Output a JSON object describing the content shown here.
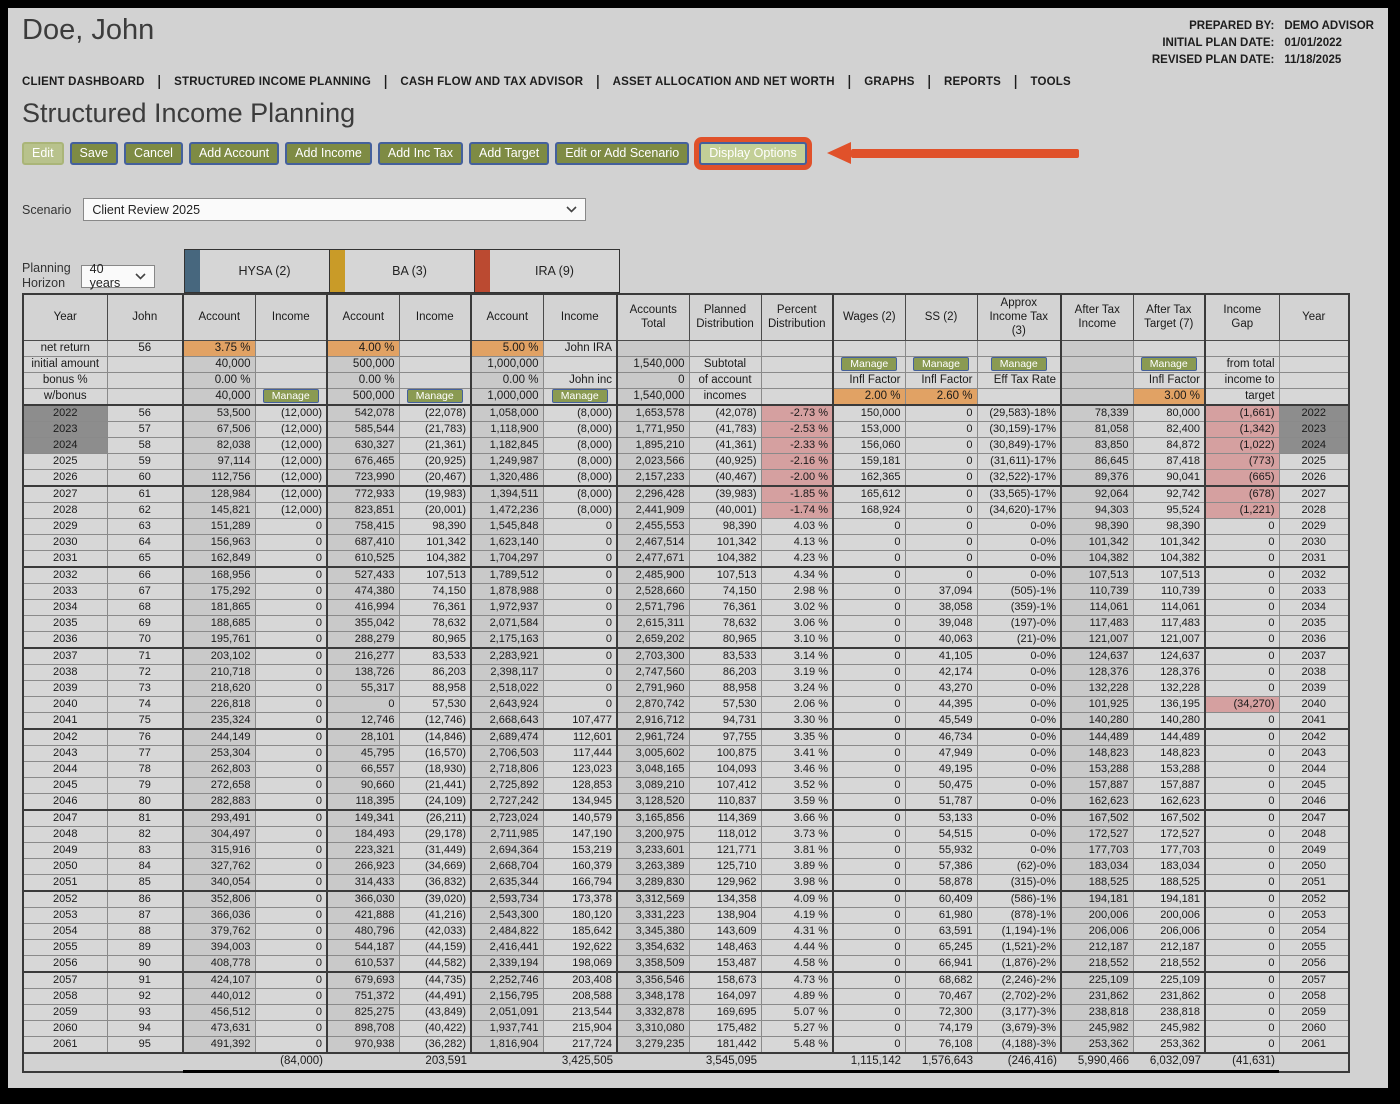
{
  "window": {
    "client_name": "Doe, John",
    "prepared_by_label": "PREPARED BY:",
    "prepared_by": "DEMO ADVISOR",
    "initial_plan_label": "INITIAL PLAN DATE:",
    "initial_plan_date": "01/01/2022",
    "revised_plan_label": "REVISED PLAN DATE:",
    "revised_plan_date": "11/18/2025"
  },
  "nav": {
    "items": [
      "CLIENT DASHBOARD",
      "STRUCTURED INCOME PLANNING",
      "CASH FLOW AND TAX ADVISOR",
      "ASSET ALLOCATION AND NET WORTH",
      "GRAPHS",
      "REPORTS",
      "TOOLS"
    ]
  },
  "page": {
    "title": "Structured Income Planning"
  },
  "toolbar": {
    "buttons": [
      {
        "label": "Edit",
        "state": "disabled"
      },
      {
        "label": "Save",
        "state": "normal"
      },
      {
        "label": "Cancel",
        "state": "normal"
      },
      {
        "label": "Add Account",
        "state": "normal"
      },
      {
        "label": "Add Income",
        "state": "normal"
      },
      {
        "label": "Add Inc Tax",
        "state": "normal"
      },
      {
        "label": "Add Target",
        "state": "normal"
      },
      {
        "label": "Edit or Add Scenario",
        "state": "normal"
      },
      {
        "label": "Display Options",
        "state": "highlighted"
      }
    ]
  },
  "scenario": {
    "label": "Scenario",
    "value": "Client Review 2025"
  },
  "planning_horizon": {
    "label": "Planning\nHorizon",
    "value": "40 years"
  },
  "accounts_legend": [
    {
      "name": "HYSA (2)",
      "color": "#47677e"
    },
    {
      "name": "BA (3)",
      "color": "#c99b28"
    },
    {
      "name": "IRA (9)",
      "color": "#bb4a31"
    }
  ],
  "colors": {
    "accent_callout": "#e0512a",
    "button_green": "#7e8b44",
    "highlight_cell": "#e1a264",
    "negative_cell": "#d5a0a0",
    "past_year_cell": "#8d8d8d"
  },
  "table": {
    "columns": [
      "Year",
      "John",
      "Account",
      "Income",
      "Account",
      "Income",
      "Account",
      "Income",
      "Accounts\nTotal",
      "Planned\nDistribution",
      "Percent\nDistribution",
      "Wages (2)",
      "SS (2)",
      "Approx\nIncome Tax\n(3)",
      "After Tax\nIncome",
      "After Tax\nTarget (7)",
      "Income\nGap",
      "Year"
    ],
    "spec_rows": [
      [
        "net return",
        "56",
        {
          "v": "3.75  %",
          "c": "hl"
        },
        "",
        {
          "v": "4.00  %",
          "c": "hl"
        },
        "",
        {
          "v": "5.00  %",
          "c": "hl"
        },
        "John IRA",
        "",
        "",
        "",
        "",
        "",
        "",
        "",
        "",
        "",
        ""
      ],
      [
        "initial amount",
        "",
        "40,000",
        "",
        "500,000",
        "",
        "1,000,000",
        "",
        "1,540,000",
        {
          "v": "Subtotal",
          "c": "ctr"
        },
        "",
        {
          "b": "Manage"
        },
        {
          "b": "Manage"
        },
        {
          "b": "Manage"
        },
        "",
        {
          "b": "Manage"
        },
        "from total",
        ""
      ],
      [
        "bonus %",
        "",
        "0.00  %",
        "",
        "0.00  %",
        "",
        "0.00  %",
        "John inc",
        "0",
        {
          "v": "of account",
          "c": "ctr"
        },
        "",
        "Infl Factor",
        "Infl Factor",
        "Eff Tax Rate",
        "",
        "Infl Factor",
        "income to",
        ""
      ],
      [
        "w/bonus",
        "",
        "40,000",
        {
          "b": "Manage"
        },
        "500,000",
        {
          "b": "Manage"
        },
        "1,000,000",
        {
          "b": "Manage"
        },
        "1,540,000",
        {
          "v": "incomes",
          "c": "ctr"
        },
        "",
        {
          "v": "2.00  %",
          "c": "hl"
        },
        {
          "v": "2.60  %",
          "c": "hl"
        },
        "",
        "",
        {
          "v": "3.00  %",
          "c": "hl"
        },
        "target",
        ""
      ]
    ],
    "rows": [
      [
        "2022",
        "56",
        "53,500",
        "(12,000)",
        "542,078",
        "(22,078)",
        "1,058,000",
        "(8,000)",
        "1,653,578",
        "(42,078)",
        "-2.73  %",
        "150,000",
        "0",
        "(29,583)-18%",
        "78,339",
        "80,000",
        "(1,661)",
        "2022"
      ],
      [
        "2023",
        "57",
        "67,506",
        "(12,000)",
        "585,544",
        "(21,783)",
        "1,118,900",
        "(8,000)",
        "1,771,950",
        "(41,783)",
        "-2.53  %",
        "153,000",
        "0",
        "(30,159)-17%",
        "81,058",
        "82,400",
        "(1,342)",
        "2023"
      ],
      [
        "2024",
        "58",
        "82,038",
        "(12,000)",
        "630,327",
        "(21,361)",
        "1,182,845",
        "(8,000)",
        "1,895,210",
        "(41,361)",
        "-2.33  %",
        "156,060",
        "0",
        "(30,849)-17%",
        "83,850",
        "84,872",
        "(1,022)",
        "2024"
      ],
      [
        "2025",
        "59",
        "97,114",
        "(12,000)",
        "676,465",
        "(20,925)",
        "1,249,987",
        "(8,000)",
        "2,023,566",
        "(40,925)",
        "-2.16  %",
        "159,181",
        "0",
        "(31,611)-17%",
        "86,645",
        "87,418",
        "(773)",
        "2025"
      ],
      [
        "2026",
        "60",
        "112,756",
        "(12,000)",
        "723,990",
        "(20,467)",
        "1,320,486",
        "(8,000)",
        "2,157,233",
        "(40,467)",
        "-2.00  %",
        "162,365",
        "0",
        "(32,522)-17%",
        "89,376",
        "90,041",
        "(665)",
        "2026"
      ],
      [
        "2027",
        "61",
        "128,984",
        "(12,000)",
        "772,933",
        "(19,983)",
        "1,394,511",
        "(8,000)",
        "2,296,428",
        "(39,983)",
        "-1.85  %",
        "165,612",
        "0",
        "(33,565)-17%",
        "92,064",
        "92,742",
        "(678)",
        "2027"
      ],
      [
        "2028",
        "62",
        "145,821",
        "(12,000)",
        "823,851",
        "(20,001)",
        "1,472,236",
        "(8,000)",
        "2,441,909",
        "(40,001)",
        "-1.74  %",
        "168,924",
        "0",
        "(34,620)-17%",
        "94,303",
        "95,524",
        "(1,221)",
        "2028"
      ],
      [
        "2029",
        "63",
        "151,289",
        "0",
        "758,415",
        "98,390",
        "1,545,848",
        "0",
        "2,455,553",
        "98,390",
        "4.03  %",
        "0",
        "0",
        "0-0%",
        "98,390",
        "98,390",
        "0",
        "2029"
      ],
      [
        "2030",
        "64",
        "156,963",
        "0",
        "687,410",
        "101,342",
        "1,623,140",
        "0",
        "2,467,514",
        "101,342",
        "4.13  %",
        "0",
        "0",
        "0-0%",
        "101,342",
        "101,342",
        "0",
        "2030"
      ],
      [
        "2031",
        "65",
        "162,849",
        "0",
        "610,525",
        "104,382",
        "1,704,297",
        "0",
        "2,477,671",
        "104,382",
        "4.23  %",
        "0",
        "0",
        "0-0%",
        "104,382",
        "104,382",
        "0",
        "2031"
      ],
      [
        "2032",
        "66",
        "168,956",
        "0",
        "527,433",
        "107,513",
        "1,789,512",
        "0",
        "2,485,900",
        "107,513",
        "4.34  %",
        "0",
        "0",
        "0-0%",
        "107,513",
        "107,513",
        "0",
        "2032"
      ],
      [
        "2033",
        "67",
        "175,292",
        "0",
        "474,380",
        "74,150",
        "1,878,988",
        "0",
        "2,528,660",
        "74,150",
        "2.98  %",
        "0",
        "37,094",
        "(505)-1%",
        "110,739",
        "110,739",
        "0",
        "2033"
      ],
      [
        "2034",
        "68",
        "181,865",
        "0",
        "416,994",
        "76,361",
        "1,972,937",
        "0",
        "2,571,796",
        "76,361",
        "3.02  %",
        "0",
        "38,058",
        "(359)-1%",
        "114,061",
        "114,061",
        "0",
        "2034"
      ],
      [
        "2035",
        "69",
        "188,685",
        "0",
        "355,042",
        "78,632",
        "2,071,584",
        "0",
        "2,615,311",
        "78,632",
        "3.06  %",
        "0",
        "39,048",
        "(197)-0%",
        "117,483",
        "117,483",
        "0",
        "2035"
      ],
      [
        "2036",
        "70",
        "195,761",
        "0",
        "288,279",
        "80,965",
        "2,175,163",
        "0",
        "2,659,202",
        "80,965",
        "3.10  %",
        "0",
        "40,063",
        "(21)-0%",
        "121,007",
        "121,007",
        "0",
        "2036"
      ],
      [
        "2037",
        "71",
        "203,102",
        "0",
        "216,277",
        "83,533",
        "2,283,921",
        "0",
        "2,703,300",
        "83,533",
        "3.14  %",
        "0",
        "41,105",
        "0-0%",
        "124,637",
        "124,637",
        "0",
        "2037"
      ],
      [
        "2038",
        "72",
        "210,718",
        "0",
        "138,726",
        "86,203",
        "2,398,117",
        "0",
        "2,747,560",
        "86,203",
        "3.19  %",
        "0",
        "42,174",
        "0-0%",
        "128,376",
        "128,376",
        "0",
        "2038"
      ],
      [
        "2039",
        "73",
        "218,620",
        "0",
        "55,317",
        "88,958",
        "2,518,022",
        "0",
        "2,791,960",
        "88,958",
        "3.24  %",
        "0",
        "43,270",
        "0-0%",
        "132,228",
        "132,228",
        "0",
        "2039"
      ],
      [
        "2040",
        "74",
        "226,818",
        "0",
        "0",
        "57,530",
        "2,643,924",
        "0",
        "2,870,742",
        "57,530",
        "2.06  %",
        "0",
        "44,395",
        "0-0%",
        "101,925",
        "136,195",
        "(34,270)",
        "2040"
      ],
      [
        "2041",
        "75",
        "235,324",
        "0",
        "12,746",
        "(12,746)",
        "2,668,643",
        "107,477",
        "2,916,712",
        "94,731",
        "3.30  %",
        "0",
        "45,549",
        "0-0%",
        "140,280",
        "140,280",
        "0",
        "2041"
      ],
      [
        "2042",
        "76",
        "244,149",
        "0",
        "28,101",
        "(14,846)",
        "2,689,474",
        "112,601",
        "2,961,724",
        "97,755",
        "3.35  %",
        "0",
        "46,734",
        "0-0%",
        "144,489",
        "144,489",
        "0",
        "2042"
      ],
      [
        "2043",
        "77",
        "253,304",
        "0",
        "45,795",
        "(16,570)",
        "2,706,503",
        "117,444",
        "3,005,602",
        "100,875",
        "3.41  %",
        "0",
        "47,949",
        "0-0%",
        "148,823",
        "148,823",
        "0",
        "2043"
      ],
      [
        "2044",
        "78",
        "262,803",
        "0",
        "66,557",
        "(18,930)",
        "2,718,806",
        "123,023",
        "3,048,165",
        "104,093",
        "3.46  %",
        "0",
        "49,195",
        "0-0%",
        "153,288",
        "153,288",
        "0",
        "2044"
      ],
      [
        "2045",
        "79",
        "272,658",
        "0",
        "90,660",
        "(21,441)",
        "2,725,892",
        "128,853",
        "3,089,210",
        "107,412",
        "3.52  %",
        "0",
        "50,475",
        "0-0%",
        "157,887",
        "157,887",
        "0",
        "2045"
      ],
      [
        "2046",
        "80",
        "282,883",
        "0",
        "118,395",
        "(24,109)",
        "2,727,242",
        "134,945",
        "3,128,520",
        "110,837",
        "3.59  %",
        "0",
        "51,787",
        "0-0%",
        "162,623",
        "162,623",
        "0",
        "2046"
      ],
      [
        "2047",
        "81",
        "293,491",
        "0",
        "149,341",
        "(26,211)",
        "2,723,024",
        "140,579",
        "3,165,856",
        "114,369",
        "3.66  %",
        "0",
        "53,133",
        "0-0%",
        "167,502",
        "167,502",
        "0",
        "2047"
      ],
      [
        "2048",
        "82",
        "304,497",
        "0",
        "184,493",
        "(29,178)",
        "2,711,985",
        "147,190",
        "3,200,975",
        "118,012",
        "3.73  %",
        "0",
        "54,515",
        "0-0%",
        "172,527",
        "172,527",
        "0",
        "2048"
      ],
      [
        "2049",
        "83",
        "315,916",
        "0",
        "223,321",
        "(31,449)",
        "2,694,364",
        "153,219",
        "3,233,601",
        "121,771",
        "3.81  %",
        "0",
        "55,932",
        "0-0%",
        "177,703",
        "177,703",
        "0",
        "2049"
      ],
      [
        "2050",
        "84",
        "327,762",
        "0",
        "266,923",
        "(34,669)",
        "2,668,704",
        "160,379",
        "3,263,389",
        "125,710",
        "3.89  %",
        "0",
        "57,386",
        "(62)-0%",
        "183,034",
        "183,034",
        "0",
        "2050"
      ],
      [
        "2051",
        "85",
        "340,054",
        "0",
        "314,433",
        "(36,832)",
        "2,635,344",
        "166,794",
        "3,289,830",
        "129,962",
        "3.98  %",
        "0",
        "58,878",
        "(315)-0%",
        "188,525",
        "188,525",
        "0",
        "2051"
      ],
      [
        "2052",
        "86",
        "352,806",
        "0",
        "366,030",
        "(39,020)",
        "2,593,734",
        "173,378",
        "3,312,569",
        "134,358",
        "4.09  %",
        "0",
        "60,409",
        "(586)-1%",
        "194,181",
        "194,181",
        "0",
        "2052"
      ],
      [
        "2053",
        "87",
        "366,036",
        "0",
        "421,888",
        "(41,216)",
        "2,543,300",
        "180,120",
        "3,331,223",
        "138,904",
        "4.19  %",
        "0",
        "61,980",
        "(878)-1%",
        "200,006",
        "200,006",
        "0",
        "2053"
      ],
      [
        "2054",
        "88",
        "379,762",
        "0",
        "480,796",
        "(42,033)",
        "2,484,822",
        "185,642",
        "3,345,380",
        "143,609",
        "4.31  %",
        "0",
        "63,591",
        "(1,194)-1%",
        "206,006",
        "206,006",
        "0",
        "2054"
      ],
      [
        "2055",
        "89",
        "394,003",
        "0",
        "544,187",
        "(44,159)",
        "2,416,441",
        "192,622",
        "3,354,632",
        "148,463",
        "4.44  %",
        "0",
        "65,245",
        "(1,521)-2%",
        "212,187",
        "212,187",
        "0",
        "2055"
      ],
      [
        "2056",
        "90",
        "408,778",
        "0",
        "610,537",
        "(44,582)",
        "2,339,194",
        "198,069",
        "3,358,509",
        "153,487",
        "4.58  %",
        "0",
        "66,941",
        "(1,876)-2%",
        "218,552",
        "218,552",
        "0",
        "2056"
      ],
      [
        "2057",
        "91",
        "424,107",
        "0",
        "679,693",
        "(44,735)",
        "2,252,746",
        "203,408",
        "3,356,546",
        "158,673",
        "4.73  %",
        "0",
        "68,682",
        "(2,246)-2%",
        "225,109",
        "225,109",
        "0",
        "2057"
      ],
      [
        "2058",
        "92",
        "440,012",
        "0",
        "751,372",
        "(44,491)",
        "2,156,795",
        "208,588",
        "3,348,178",
        "164,097",
        "4.89  %",
        "0",
        "70,467",
        "(2,702)-2%",
        "231,862",
        "231,862",
        "0",
        "2058"
      ],
      [
        "2059",
        "93",
        "456,512",
        "0",
        "825,275",
        "(43,849)",
        "2,051,091",
        "213,544",
        "3,332,878",
        "169,695",
        "5.07  %",
        "0",
        "72,300",
        "(3,177)-3%",
        "238,818",
        "238,818",
        "0",
        "2059"
      ],
      [
        "2060",
        "94",
        "473,631",
        "0",
        "898,708",
        "(40,422)",
        "1,937,741",
        "215,904",
        "3,310,080",
        "175,482",
        "5.27  %",
        "0",
        "74,179",
        "(3,679)-3%",
        "245,982",
        "245,982",
        "0",
        "2060"
      ],
      [
        "2061",
        "95",
        "491,392",
        "0",
        "970,938",
        "(36,282)",
        "1,816,904",
        "217,724",
        "3,279,235",
        "181,442",
        "5.48  %",
        "0",
        "76,108",
        "(4,188)-3%",
        "253,362",
        "253,362",
        "0",
        "2061"
      ]
    ],
    "totals": [
      "",
      "",
      "",
      "(84,000)",
      "",
      "203,591",
      "",
      "3,425,505",
      "",
      "3,545,095",
      "",
      "1,115,142",
      "1,576,643",
      "(246,416)",
      "5,990,466",
      "6,032,097",
      "(41,631)",
      ""
    ]
  }
}
